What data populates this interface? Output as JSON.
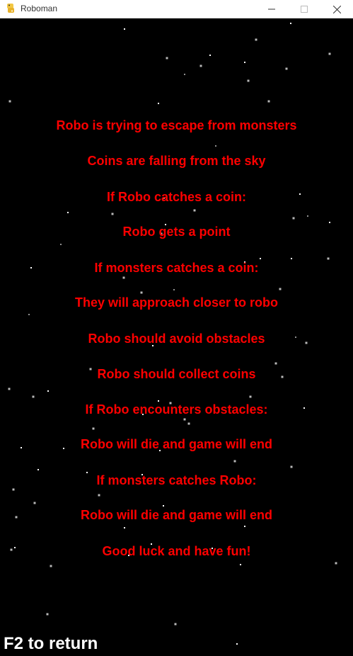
{
  "window": {
    "title": "Roboman",
    "icon": "python-icon"
  },
  "colors": {
    "text": "#ff0000",
    "footer": "#ffffff",
    "background": "#000000"
  },
  "instructions": [
    "Robo is trying to escape from monsters",
    "Coins are falling from the sky",
    "If Robo catches a coin:",
    "Robo gets a point",
    "If monsters catches a coin:",
    "They will approach closer to robo",
    "Robo should avoid obstacles",
    "Robo should collect coins",
    "If Robo encounters obstacles:",
    "Robo will die and game will end",
    "If monsters catches Robo:",
    "Robo will die and game will end",
    "Good luck and have fun!"
  ],
  "footer": {
    "hint": "F2 to return"
  }
}
